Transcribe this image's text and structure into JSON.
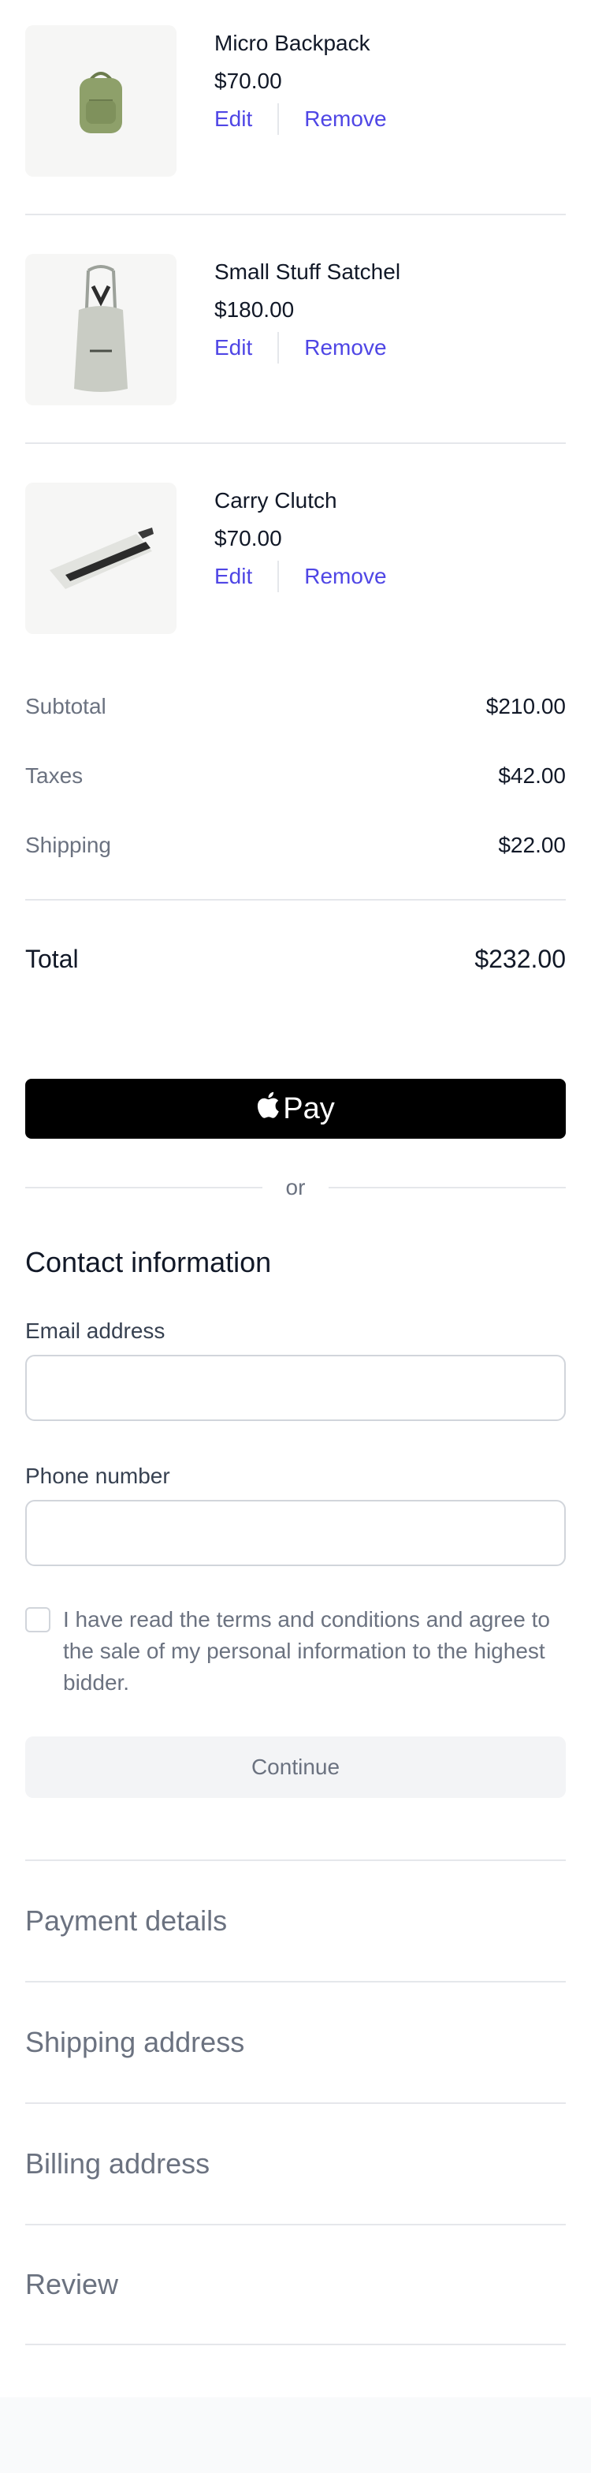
{
  "cart": {
    "items": [
      {
        "name": "Micro Backpack",
        "price": "$70.00",
        "edit": "Edit",
        "remove": "Remove",
        "image_icon": "backpack-image"
      },
      {
        "name": "Small Stuff Satchel",
        "price": "$180.00",
        "edit": "Edit",
        "remove": "Remove",
        "image_icon": "satchel-image"
      },
      {
        "name": "Carry Clutch",
        "price": "$70.00",
        "edit": "Edit",
        "remove": "Remove",
        "image_icon": "clutch-image"
      }
    ]
  },
  "summary": {
    "subtotal_label": "Subtotal",
    "subtotal_value": "$210.00",
    "taxes_label": "Taxes",
    "taxes_value": "$42.00",
    "shipping_label": "Shipping",
    "shipping_value": "$22.00",
    "total_label": "Total",
    "total_value": "$232.00"
  },
  "applepay": {
    "label": "Pay",
    "icon": "apple-icon"
  },
  "divider_text": "or",
  "contact": {
    "title": "Contact information",
    "email_label": "Email address",
    "email_value": "",
    "email_placeholder": "",
    "phone_label": "Phone number",
    "phone_value": "",
    "phone_placeholder": "",
    "terms_text": "I have read the terms and conditions and agree to the sale of my personal information to the highest bidder.",
    "terms_checked": false,
    "continue_label": "Continue"
  },
  "steps": [
    "Payment details",
    "Shipping address",
    "Billing address",
    "Review"
  ],
  "colors": {
    "accent": "#4f46e5",
    "text": "#111827",
    "muted": "#6b7280",
    "border": "#e5e7eb",
    "button_bg": "#000000"
  }
}
